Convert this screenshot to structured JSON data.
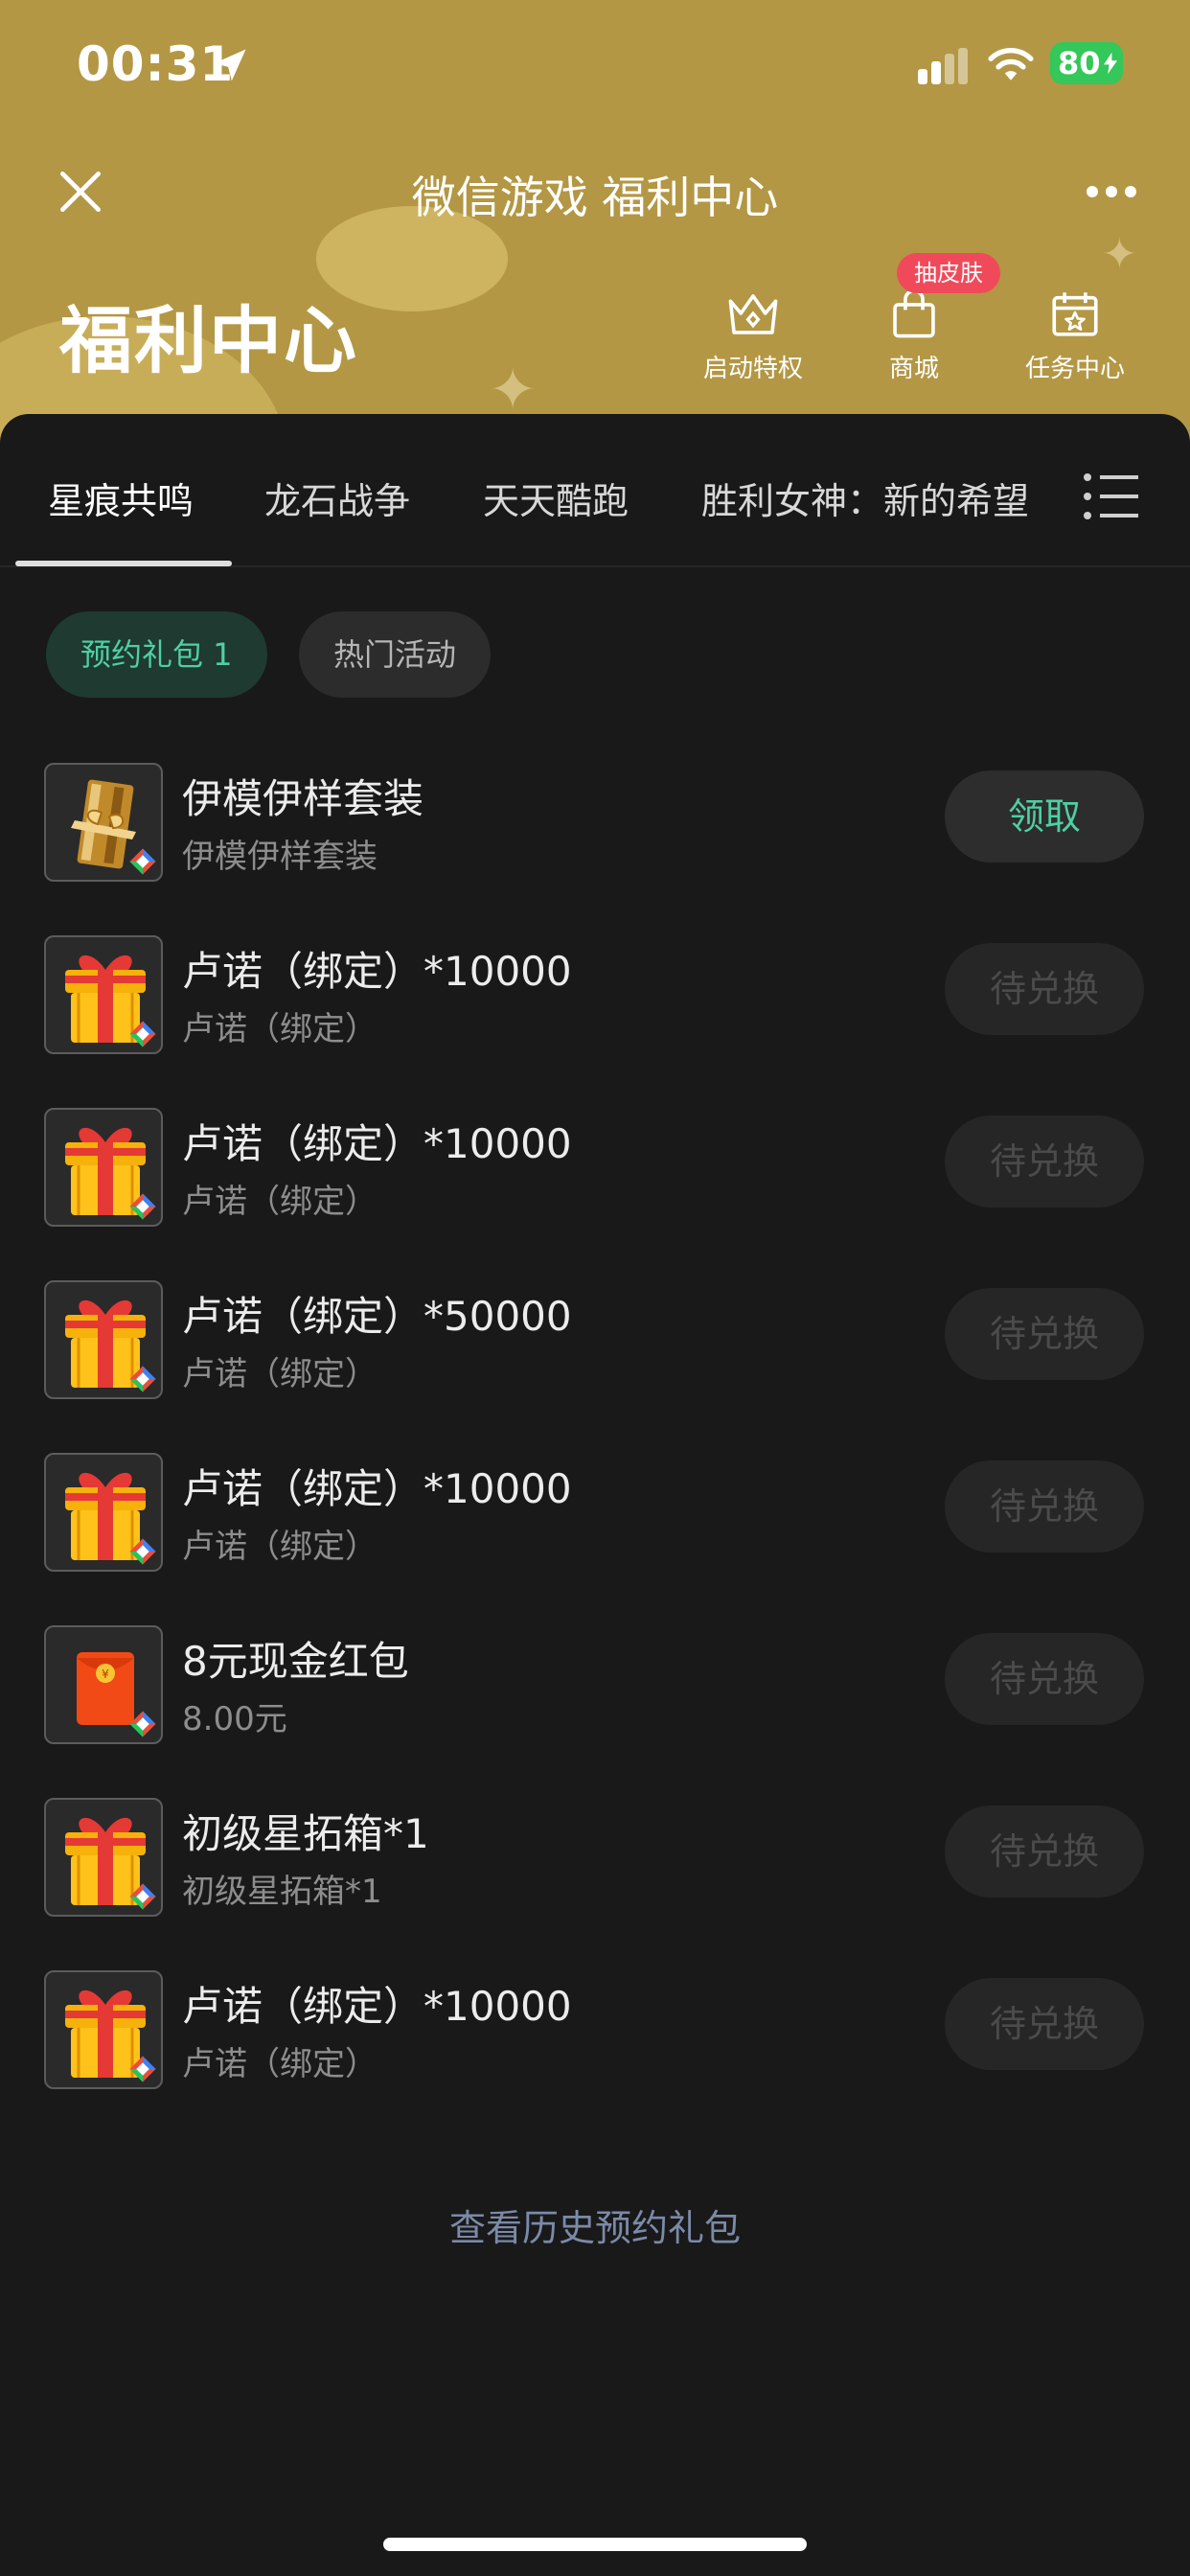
{
  "status_bar": {
    "time": "00:31",
    "battery": "80"
  },
  "navbar": {
    "title": "微信游戏 福利中心"
  },
  "hero": {
    "title": "福利中心"
  },
  "quick_actions": [
    {
      "label": "启动特权",
      "icon": "crown-icon"
    },
    {
      "label": "商城",
      "icon": "shopping-bag-icon",
      "badge": "抽皮肤"
    },
    {
      "label": "任务中心",
      "icon": "calendar-star-icon"
    }
  ],
  "tabs": [
    "星痕共鸣",
    "龙石战争",
    "天天酷跑",
    "胜利女神：新的希望"
  ],
  "chips": {
    "active": "预约礼包 1",
    "inactive": "热门活动"
  },
  "items": [
    {
      "title": "伊模伊样套装",
      "subtitle": "伊模伊样套装",
      "button": "领取",
      "icon": "outfit-box-icon"
    },
    {
      "title": "卢诺（绑定）*10000",
      "subtitle": "卢诺（绑定）",
      "button": "待兑换",
      "icon": "gift-box-icon"
    },
    {
      "title": "卢诺（绑定）*10000",
      "subtitle": "卢诺（绑定）",
      "button": "待兑换",
      "icon": "gift-box-icon"
    },
    {
      "title": "卢诺（绑定）*50000",
      "subtitle": "卢诺（绑定）",
      "button": "待兑换",
      "icon": "gift-box-icon"
    },
    {
      "title": "卢诺（绑定）*10000",
      "subtitle": "卢诺（绑定）",
      "button": "待兑换",
      "icon": "gift-box-icon"
    },
    {
      "title": "8元现金红包",
      "subtitle": "8.00元",
      "button": "待兑换",
      "icon": "red-envelope-icon"
    },
    {
      "title": "初级星拓箱*1",
      "subtitle": "初级星拓箱*1",
      "button": "待兑换",
      "icon": "gift-box-icon"
    },
    {
      "title": "卢诺（绑定）*10000",
      "subtitle": "卢诺（绑定）",
      "button": "待兑换",
      "icon": "gift-box-icon"
    }
  ],
  "history_link": "查看历史预约礼包",
  "colors": {
    "header_gold": "#b39744",
    "sheet_bg": "#191919",
    "accent_green": "#4fcfa4",
    "badge_red": "#f04a5a",
    "battery_green": "#34c759"
  }
}
